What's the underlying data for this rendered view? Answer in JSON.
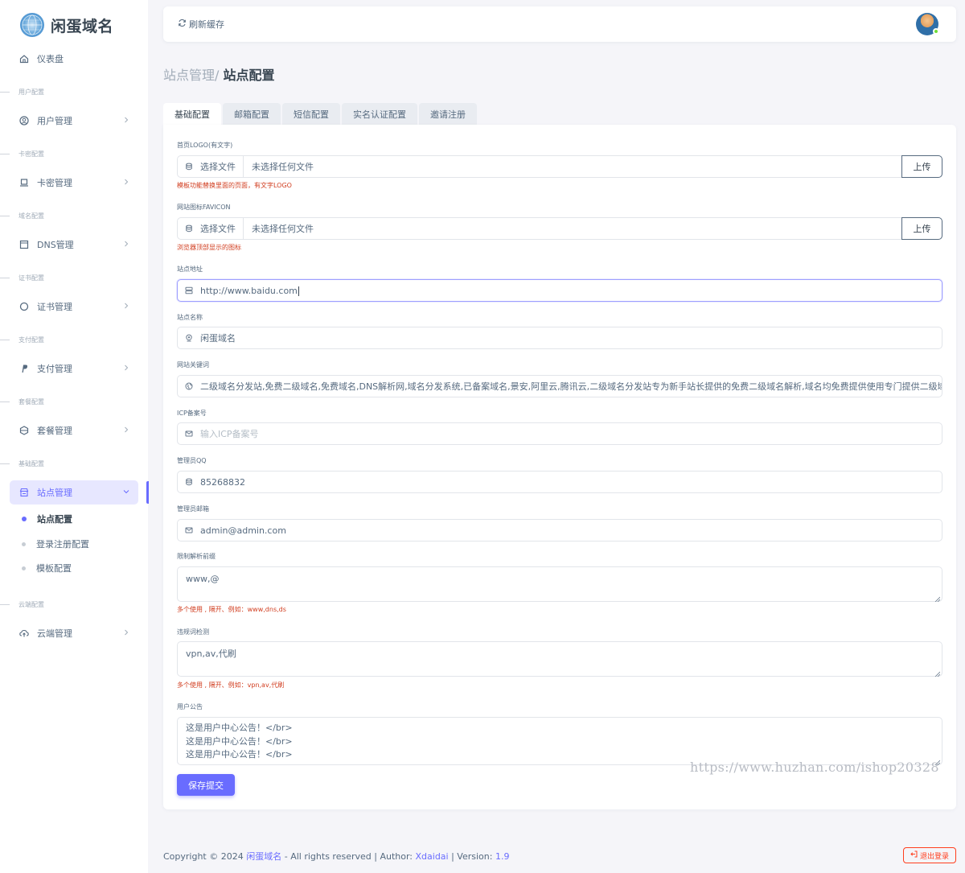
{
  "brand": {
    "name": "闲蛋域名"
  },
  "sidebar": {
    "dashboard": "仪表盘",
    "sections": [
      "用户配置",
      "卡密配置",
      "域名配置",
      "证书配置",
      "支付配置",
      "套餐配置",
      "基础配置",
      "云端配置"
    ],
    "items": [
      {
        "label": "用户管理",
        "icon": "user-circle-icon"
      },
      {
        "label": "卡密管理",
        "icon": "laptop-icon"
      },
      {
        "label": "DNS管理",
        "icon": "window-icon"
      },
      {
        "label": "证书管理",
        "icon": "circle-icon"
      },
      {
        "label": "支付管理",
        "icon": "paypal-icon"
      },
      {
        "label": "套餐管理",
        "icon": "package-icon"
      },
      {
        "label": "站点管理",
        "icon": "store-icon"
      },
      {
        "label": "云端管理",
        "icon": "cloud-upload-icon"
      }
    ],
    "sub_items": [
      "站点配置",
      "登录注册配置",
      "模板配置"
    ]
  },
  "topbar": {
    "refresh": "刷新缓存"
  },
  "breadcrumb": {
    "parent": "站点管理/",
    "current": "站点配置"
  },
  "tabs": [
    "基础配置",
    "邮箱配置",
    "短信配置",
    "实名认证配置",
    "邀请注册"
  ],
  "form": {
    "logo": {
      "label": "首页LOGO(有文字)",
      "pick": "选择文件",
      "filename": "未选择任何文件",
      "upload": "上传",
      "help": "模板功能替换里面的页面，有文字LOGO"
    },
    "favicon": {
      "label": "网站图标FAVICON",
      "pick": "选择文件",
      "filename": "未选择任何文件",
      "upload": "上传",
      "help": "浏览器顶部显示的图标"
    },
    "site_url": {
      "label": "站点地址",
      "value": "http://www.baidu.com"
    },
    "site_name": {
      "label": "站点名称",
      "value": "闲蛋域名"
    },
    "keywords": {
      "label": "网站关键词",
      "value": "二级域名分发站,免费二级域名,免费域名,DNS解析网,域名分发系统,已备案域名,景安,阿里云,腾讯云,二级域名分发站专为新手站长提供的免费二级域名解析,域名均免费提供使用专门提供二级域名解"
    },
    "icp": {
      "label": "ICP备案号",
      "placeholder": "输入ICP备案号"
    },
    "qq": {
      "label": "管理员QQ",
      "value": "85268832"
    },
    "email": {
      "label": "管理员邮箱",
      "value": "admin@admin.com"
    },
    "prefix": {
      "label": "限制解析前缀",
      "value": "www,@",
      "help": "多个使用 , 隔开、例如：www,dns,ds"
    },
    "banned": {
      "label": "违规词检测",
      "value": "vpn,av,代刷",
      "help": "多个使用 , 隔开、例如：vpn,av,代刷"
    },
    "notice": {
      "label": "用户公告",
      "lines": [
        "这是用户中心公告！</br>",
        "这是用户中心公告！</br>",
        "这是用户中心公告！</br>"
      ]
    },
    "save": "保存提交"
  },
  "watermark": "https://www.huzhan.com/ishop20328",
  "footer": {
    "copyright": "Copyright © 2024",
    "site": "闲蛋域名",
    "rights": "- All rights reserved | Author:",
    "author": "Xdaidai",
    "version_label": "| Version:",
    "version": "1.9",
    "logout": "退出登录"
  },
  "colors": {
    "accent": "#696cff",
    "danger": "#ff3e1d",
    "background": "#f5f5f9"
  }
}
